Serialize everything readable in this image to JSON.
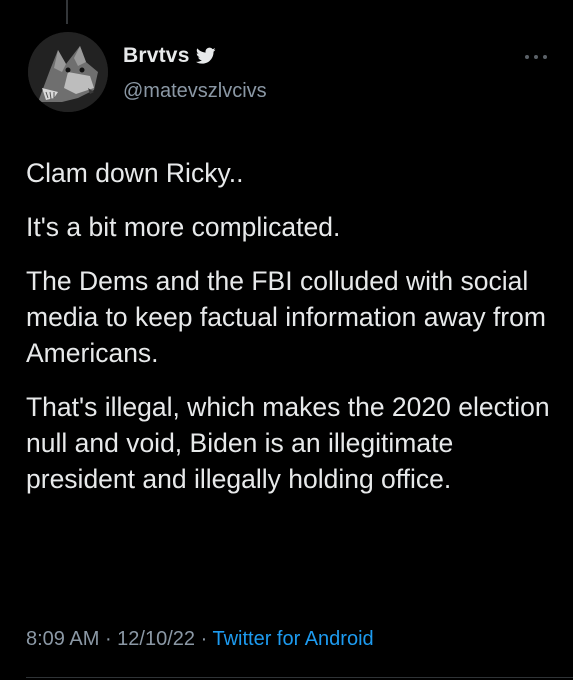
{
  "author": {
    "display_name": "Brvtvs",
    "handle": "@matevszlvcivs",
    "avatar_icon": "wolf-avatar",
    "badge_icon": "twitter-bird-icon"
  },
  "tweet": {
    "paragraphs": [
      "Clam down Ricky..",
      "It's a bit more complicated.",
      "The Dems and the FBI colluded with social media to keep factual information away from Americans.",
      "That's illegal, which makes the 2020 election null and void, Biden is an illegitimate president and illegally holding office."
    ]
  },
  "meta": {
    "time": "8:09 AM",
    "separator": " · ",
    "date": "12/10/22",
    "source": "Twitter for Android"
  },
  "colors": {
    "background": "#000000",
    "text_primary": "#e7e9ea",
    "text_secondary": "#8b98a5",
    "accent": "#1d9bf0"
  }
}
